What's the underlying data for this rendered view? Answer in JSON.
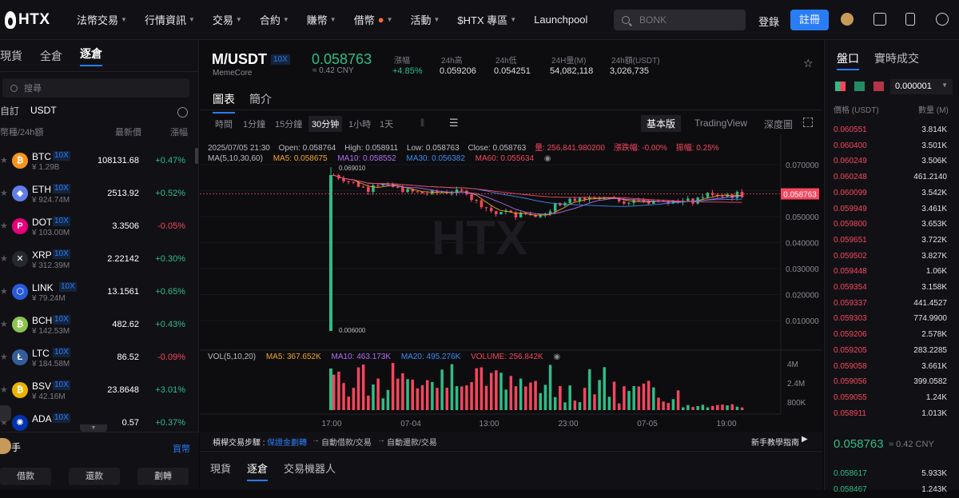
{
  "header": {
    "logo": "HTX",
    "nav": [
      "法幣交易",
      "行情資訊",
      "交易",
      "合約",
      "賺幣",
      "借幣",
      "活動",
      "$HTX 專區",
      "Launchpool"
    ],
    "search_placeholder": "BONK",
    "login": "登錄",
    "register": "註冊"
  },
  "left": {
    "tabs": [
      "現貨",
      "全倉",
      "逐倉"
    ],
    "search_placeholder": "搜尋",
    "filter": [
      "自訂",
      "USDT"
    ],
    "headers": [
      "幣種/24h額",
      "最新價",
      "漲幅"
    ],
    "rows": [
      {
        "sym": "BTC",
        "lev": "10X",
        "vol": "¥ 1.29B",
        "price": "108131.68",
        "chg": "+0.47%",
        "color": "#f7931a",
        "glyph": "₿"
      },
      {
        "sym": "ETH",
        "lev": "10X",
        "vol": "¥ 924.74M",
        "price": "2513.92",
        "chg": "+0.52%",
        "color": "#627eea",
        "glyph": "◆"
      },
      {
        "sym": "DOT",
        "lev": "10X",
        "vol": "¥ 103.00M",
        "price": "3.3506",
        "chg": "-0.05%",
        "color": "#e6007a",
        "glyph": "P"
      },
      {
        "sym": "XRP",
        "lev": "10X",
        "vol": "¥ 312.39M",
        "price": "2.22142",
        "chg": "+0.30%",
        "color": "#23292f",
        "glyph": "✕"
      },
      {
        "sym": "LINK",
        "lev": "10X",
        "vol": "¥ 79.24M",
        "price": "13.1561",
        "chg": "+0.65%",
        "color": "#2a5ada",
        "glyph": "⬡"
      },
      {
        "sym": "BCH",
        "lev": "10X",
        "vol": "¥ 142.53M",
        "price": "482.62",
        "chg": "+0.43%",
        "color": "#8dc351",
        "glyph": "₿"
      },
      {
        "sym": "LTC",
        "lev": "10X",
        "vol": "¥ 184.58M",
        "price": "86.52",
        "chg": "-0.09%",
        "color": "#345d9d",
        "glyph": "Ł"
      },
      {
        "sym": "BSV",
        "lev": "10X",
        "vol": "¥ 42.16M",
        "price": "23.8648",
        "chg": "+3.01%",
        "color": "#eab300",
        "glyph": "₿"
      },
      {
        "sym": "ADA",
        "lev": "10X",
        "vol": "",
        "price": "0.57",
        "chg": "+0.37%",
        "color": "#0033ad",
        "glyph": "✺"
      }
    ],
    "bottom_title": "手",
    "bottom_link": "買幣",
    "buttons": [
      "借款",
      "還款",
      "劃轉"
    ]
  },
  "ticker": {
    "pair": "M/USDT",
    "lev": "10X",
    "sub": "MemeCore",
    "price": "0.058763",
    "cny": "≈ 0.42 CNY",
    "stats": [
      {
        "label": "漲幅",
        "value": "+4.85%"
      },
      {
        "label": "24h高",
        "value": "0.059206"
      },
      {
        "label": "24h低",
        "value": "0.054251"
      },
      {
        "label": "24H量(M)",
        "value": "54,082,118"
      },
      {
        "label": "24h額(USDT)",
        "value": "3,026,735"
      }
    ]
  },
  "view_tabs": [
    "圖表",
    "簡介"
  ],
  "intervals": [
    "時間",
    "1分鐘",
    "15分鐘",
    "30分钟",
    "1小時",
    "1天"
  ],
  "chart_modes": [
    "基本版",
    "TradingView",
    "深度圖"
  ],
  "ohlc_line": {
    "date": "2025/07/05 21:30",
    "open": "Open: 0.058764",
    "high": "High: 0.058911",
    "low": "Low: 0.058763",
    "close": "Close: 0.058763",
    "vol": "量: 256,841.980200",
    "chgpct": "漲跌幅: -0.00%",
    "amp": "振幅: 0.25%"
  },
  "ma_line": {
    "label": "MA(5,10,30,60)",
    "ma5": "MA5: 0.058675",
    "ma10": "MA10: 0.058552",
    "ma30": "MA30: 0.056382",
    "ma60": "MA60: 0.055634"
  },
  "vol_line": {
    "label": "VOL(5,10,20)",
    "ma5": "MA5: 367.652K",
    "ma10": "MA10: 463.173K",
    "ma20": "MA20: 495.276K",
    "volume": "VOLUME: 256.842K"
  },
  "chart_data": {
    "type": "candlestick",
    "x_ticks": [
      "17:00",
      "07-04",
      "13:00",
      "23:00",
      "07-05",
      "19:00"
    ],
    "y_ticks": [
      "0.070000",
      "0.060000",
      "0.050000",
      "0.040000",
      "0.030000",
      "0.020000",
      "0.010000"
    ],
    "vol_ticks": [
      "4M",
      "2.4M",
      "800K"
    ],
    "last_price": "0.058763",
    "high_label": "0.069010",
    "low_label": "0.006000",
    "watermark": "HTX"
  },
  "footer_bar": {
    "label": "槓桿交易步驟 :",
    "steps": [
      "保證金劃轉",
      "自動借款/交易",
      "自動還款/交易"
    ],
    "guide": "新手教學指南"
  },
  "bottom_tabs": [
    "現貨",
    "逐倉",
    "交易機器人"
  ],
  "orderbook": {
    "tabs": [
      "盤口",
      "實時成交"
    ],
    "precision": "0.000001",
    "headers": [
      "價格 (USDT)",
      "數量 (M)"
    ],
    "asks": [
      [
        "0.060551",
        "3.814K"
      ],
      [
        "0.060400",
        "3.501K"
      ],
      [
        "0.060249",
        "3.506K"
      ],
      [
        "0.060248",
        "461.2140"
      ],
      [
        "0.060099",
        "3.542K"
      ],
      [
        "0.059949",
        "3.461K"
      ],
      [
        "0.059800",
        "3.653K"
      ],
      [
        "0.059651",
        "3.722K"
      ],
      [
        "0.059502",
        "3.827K"
      ],
      [
        "0.059448",
        "1.06K"
      ],
      [
        "0.059354",
        "3.158K"
      ],
      [
        "0.059337",
        "441.4527"
      ],
      [
        "0.059303",
        "774.9900"
      ],
      [
        "0.059206",
        "2.578K"
      ],
      [
        "0.059205",
        "283.2285"
      ],
      [
        "0.059058",
        "3.661K"
      ],
      [
        "0.059056",
        "399.0582"
      ],
      [
        "0.059055",
        "1.24K"
      ],
      [
        "0.058911",
        "1.013K"
      ]
    ],
    "mid_price": "0.058763",
    "mid_cny": "≈ 0.42 CNY",
    "bids": [
      [
        "0.058617",
        "5.933K"
      ],
      [
        "0.058467",
        "1.243K"
      ]
    ]
  }
}
